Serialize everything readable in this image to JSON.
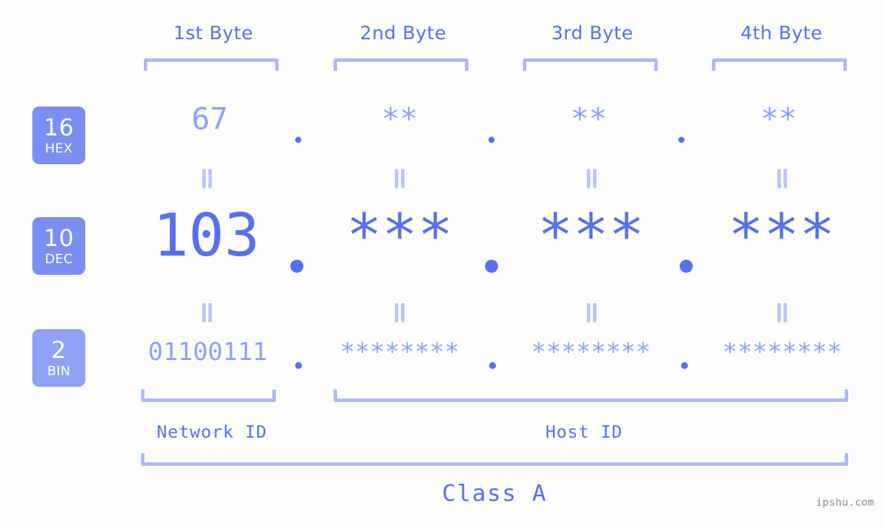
{
  "background_color": "#fcfdfa",
  "accent_strong": "#5571ef",
  "accent_light": "#8fa2f7",
  "accent_bracket": "#adb8f7",
  "accent_equals": "#bcc5f9",
  "header": {
    "bytes": [
      {
        "label": "1st Byte"
      },
      {
        "label": "2nd Byte"
      },
      {
        "label": "3rd Byte"
      },
      {
        "label": "4th Byte"
      }
    ]
  },
  "rows": [
    {
      "id": "hex",
      "base_number": "16",
      "base_name": "HEX",
      "values": [
        "67",
        "**",
        "**",
        "**"
      ],
      "separators": [
        ".",
        ".",
        "."
      ]
    },
    {
      "id": "dec",
      "base_number": "10",
      "base_name": "DEC",
      "values": [
        "103",
        "***",
        "***",
        "***"
      ],
      "separators": [
        ".",
        ".",
        "."
      ]
    },
    {
      "id": "bin",
      "base_number": "2",
      "base_name": "BIN",
      "values": [
        "01100111",
        "********",
        "********",
        "********"
      ],
      "separators": [
        ".",
        ".",
        "."
      ]
    }
  ],
  "equals_separator": "||",
  "footer": {
    "network_id_label": "Network ID",
    "host_id_label": "Host ID",
    "class_label": "Class A"
  },
  "watermark": "ipshu.com"
}
